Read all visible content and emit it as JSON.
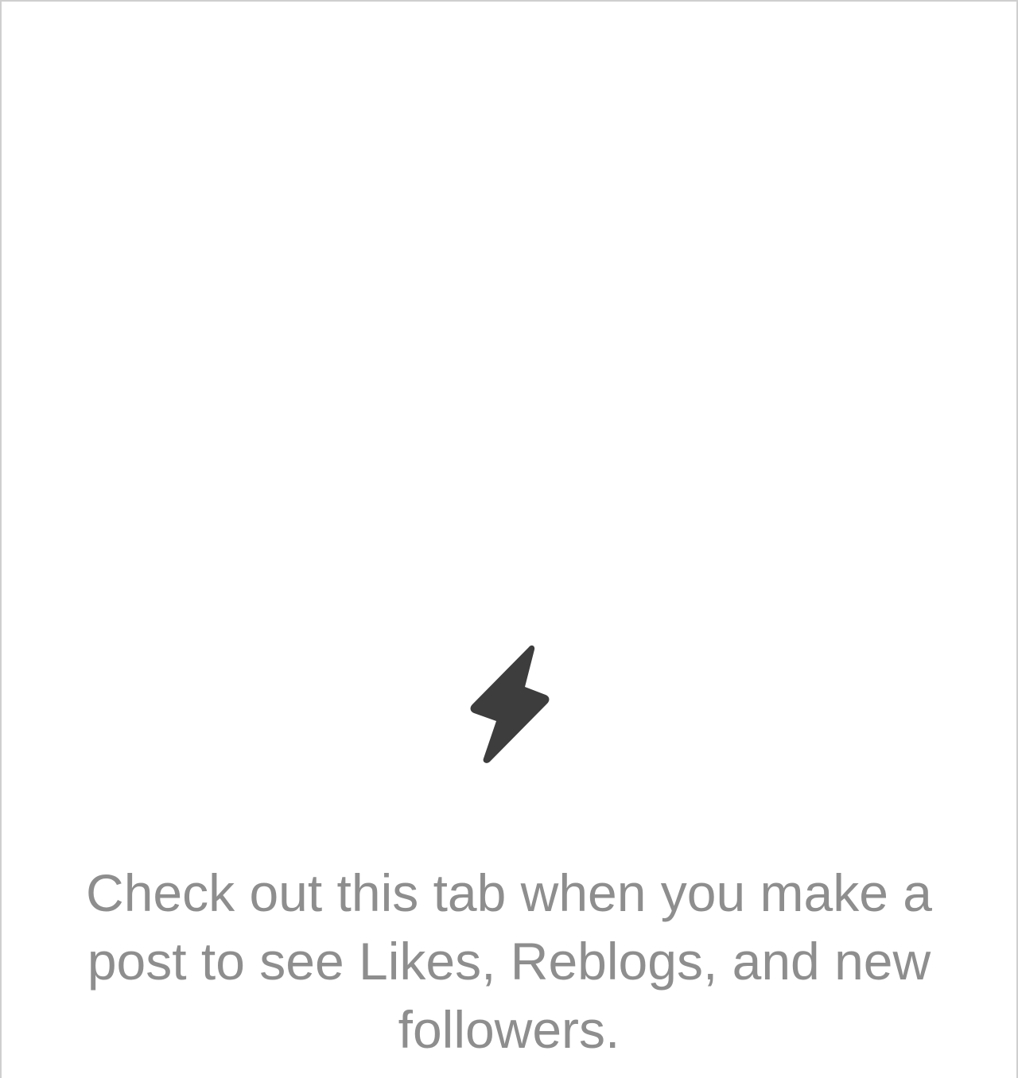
{
  "activity": {
    "empty_state": {
      "icon": "lightning-bolt-icon",
      "icon_color": "#3d3d3d",
      "message": "Check out this tab when you make a post to see Likes, Reblogs, and new followers."
    }
  },
  "colors": {
    "background": "#ffffff",
    "message_text": "#8e8e8e",
    "frame_border": "#cfcfcf"
  }
}
